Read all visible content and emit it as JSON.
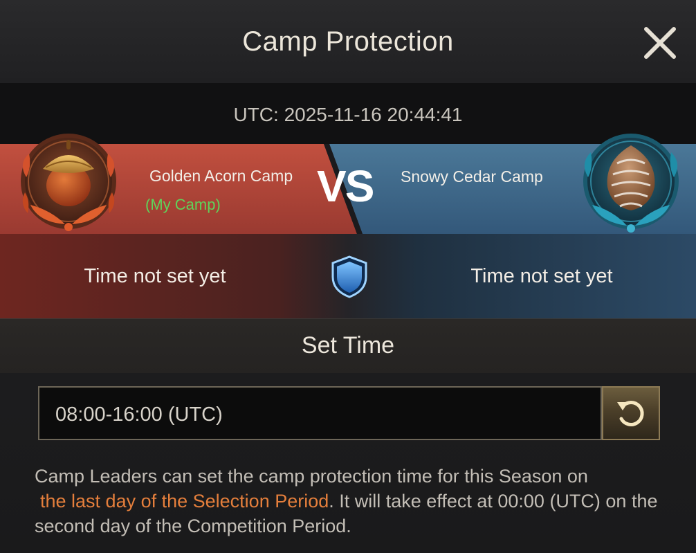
{
  "dialog": {
    "title": "Camp Protection"
  },
  "utc_time": "UTC: 2025-11-16 20:44:41",
  "left_camp": {
    "name": "Golden Acorn Camp",
    "tag": "(My Camp)",
    "protection_time": "Time not set yet",
    "color": "#b2463c"
  },
  "right_camp": {
    "name": "Snowy Cedar Camp",
    "protection_time": "Time not set yet",
    "color": "#3c6586"
  },
  "vs_label": "VS",
  "set_time": {
    "heading": "Set Time",
    "value": "08:00-16:00 (UTC)"
  },
  "description": {
    "part1": "Camp Leaders can set the camp protection time for this Season on",
    "highlight": "the last day of the Selection Period",
    "part2": ". It will take effect at 00:00 (UTC) on the second day of the Competition Period.",
    "highlight_color": "#e57f3c"
  },
  "icons": {
    "close": "close-icon",
    "left_emblem": "acorn-emblem-icon",
    "right_emblem": "pinecone-emblem-icon",
    "shield": "shield-icon",
    "reset": "reset-icon"
  }
}
